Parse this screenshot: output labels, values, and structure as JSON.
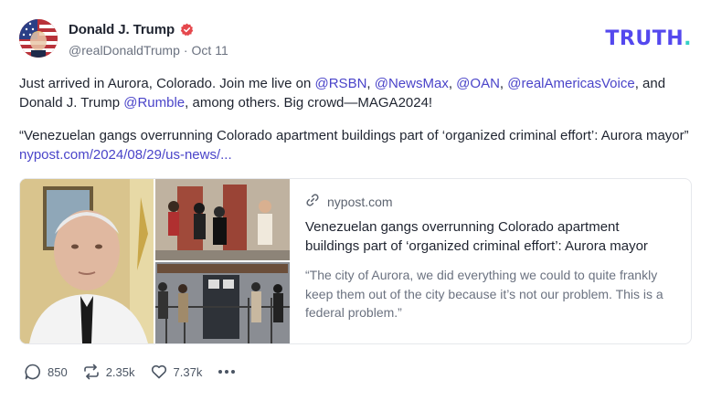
{
  "author": {
    "display_name": "Donald J. Trump",
    "handle": "@realDonaldTrump",
    "separator": "·",
    "date": "Oct 11"
  },
  "brand": {
    "logo_text": "TRUTH",
    "logo_dot": ".",
    "accent": "#5448ee"
  },
  "post": {
    "p1_part1": "Just arrived in Aurora, Colorado. Join me live on ",
    "m_rsbn": "@RSBN",
    "comma1": ", ",
    "m_newsmax": "@NewsMax",
    "comma2": ", ",
    "m_oan": "@OAN",
    "comma3": ", ",
    "m_rav": "@realAmericasVoice",
    "p1_part2": ", and Donald J. Trump ",
    "m_rumble": "@Rumble",
    "p1_part3": ", among others. Big crowd—MAGA2024!",
    "p2_text": "“Venezuelan gangs overrunning Colorado apartment buildings part of ‘organized criminal effort’: Aurora mayor” ",
    "p2_link": "nypost.com/2024/08/29/us-news/..."
  },
  "card": {
    "domain": "nypost.com",
    "title": "Venezuelan gangs overrunning Colorado apartment buildings part of ‘organized criminal effort’: Aurora mayor",
    "description": "“The city of Aurora, we did everything we could to quite frankly keep them out of the city because it’s not our problem. This is a federal problem.”"
  },
  "actions": {
    "replies": "850",
    "retruths": "2.35k",
    "likes": "7.37k"
  },
  "colors": {
    "mention": "#4a44c9",
    "verified": "#e5484d",
    "logo_dot": "#35d0c6"
  }
}
